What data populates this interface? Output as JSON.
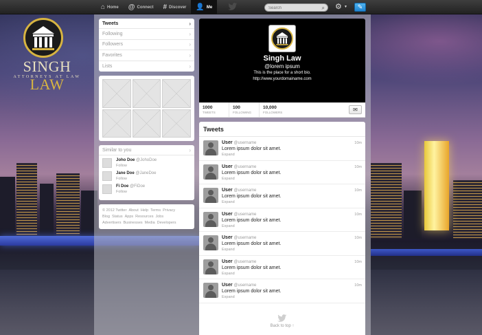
{
  "nav": {
    "items": [
      {
        "label": "Home",
        "icon": "home-icon"
      },
      {
        "label": "Connect",
        "icon": "at-icon"
      },
      {
        "label": "Discover",
        "icon": "hash-icon"
      },
      {
        "label": "Me",
        "icon": "person-icon"
      }
    ],
    "active": "Me",
    "search_placeholder": "Search",
    "accent": "#3fa9f5"
  },
  "brand": {
    "name_part1": "SINGH",
    "name_part2": "LAW",
    "tagline": "ATTORNEYS AT LAW",
    "gold": "#d7b441"
  },
  "left_menu": [
    {
      "label": "Tweets",
      "active": true
    },
    {
      "label": "Following",
      "active": false
    },
    {
      "label": "Followers",
      "active": false
    },
    {
      "label": "Favorites",
      "active": false
    },
    {
      "label": "Lists",
      "active": false
    }
  ],
  "similar": {
    "title": "Similar to you",
    "users": [
      {
        "name": "Joho Doe",
        "handle": "@JohoDoe",
        "action": "Follow"
      },
      {
        "name": "Jane Doe",
        "handle": "@JaneDoe",
        "action": "Follow"
      },
      {
        "name": "Fi Doe",
        "handle": "@FiDoe",
        "action": "Follow"
      }
    ]
  },
  "footer_links": [
    "© 2012 Twitter",
    "About",
    "Help",
    "Terms",
    "Privacy",
    "Blog",
    "Status",
    "Apps",
    "Resources",
    "Jobs",
    "Advertisers",
    "Businesses",
    "Media",
    "Developers"
  ],
  "profile": {
    "name": "Singh Law",
    "handle": "@lorem ipsum",
    "bio": "This is the place for a short bio.",
    "url": "http://www.yourdomainame.com"
  },
  "stats": [
    {
      "value": "1000",
      "label": "TWEETS"
    },
    {
      "value": "100",
      "label": "FOLLOWING"
    },
    {
      "value": "10,000",
      "label": "FOLLOWERS"
    }
  ],
  "tweets_title": "Tweets",
  "tweets": [
    {
      "user": "User",
      "handle": "@username",
      "text": "Lorem ipsum dolor sit amet.",
      "expand": "Expand",
      "time": "10m"
    },
    {
      "user": "User",
      "handle": "@username",
      "text": "Lorem ipsum dolor sit amet.",
      "expand": "Expand",
      "time": "10m"
    },
    {
      "user": "User",
      "handle": "@username",
      "text": "Lorem ipsum dolor sit amet.",
      "expand": "Expand",
      "time": "10m"
    },
    {
      "user": "User",
      "handle": "@username",
      "text": "Lorem ipsum dolor sit amet.",
      "expand": "Expand",
      "time": "10m"
    },
    {
      "user": "User",
      "handle": "@username",
      "text": "Lorem ipsum dolor sit amet.",
      "expand": "Expand",
      "time": "10m"
    },
    {
      "user": "User",
      "handle": "@username",
      "text": "Lorem ipsum dolor sit amet.",
      "expand": "Expand",
      "time": "10m"
    },
    {
      "user": "User",
      "handle": "@username",
      "text": "Lorem ipsum dolor sit amet.",
      "expand": "Expand",
      "time": "10m"
    }
  ],
  "back_to_top": "Back to top ↑"
}
